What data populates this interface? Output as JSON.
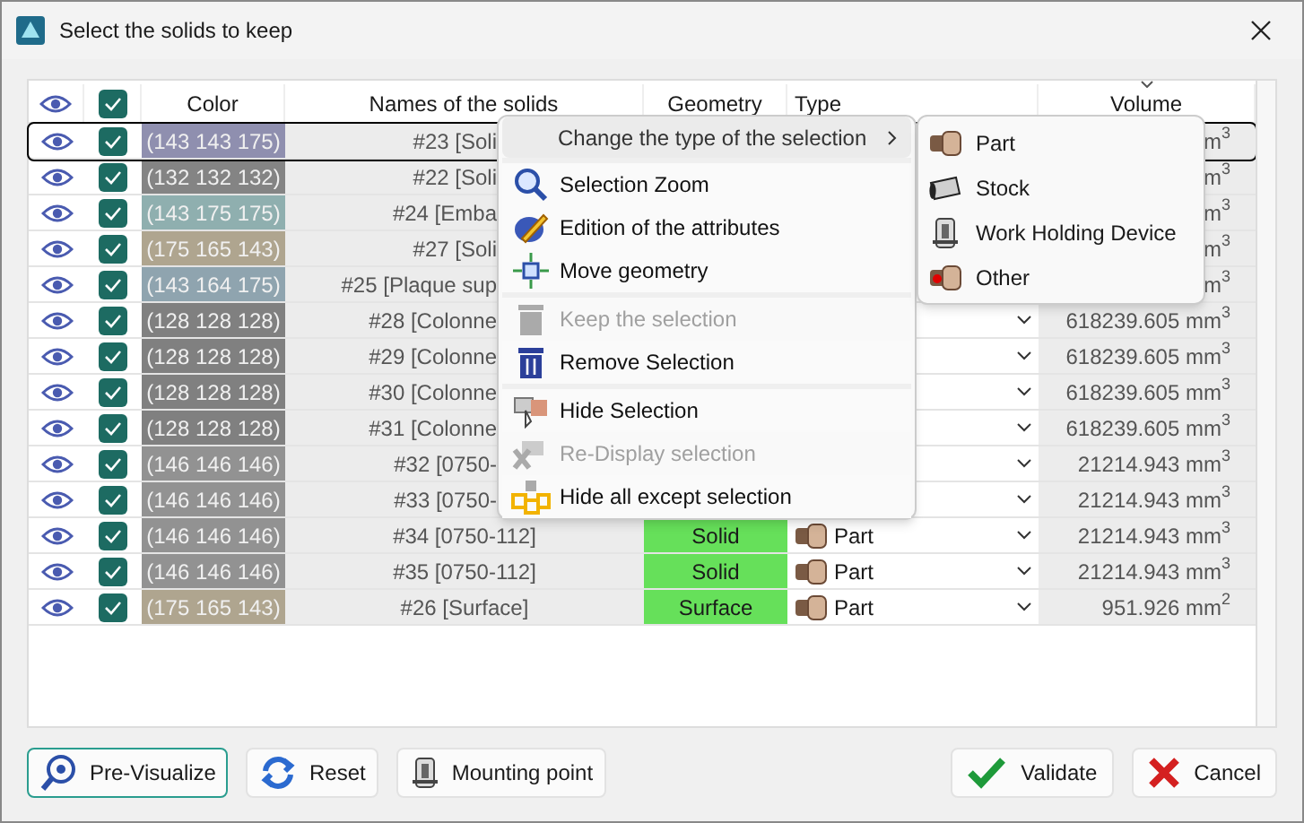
{
  "window": {
    "title": "Select the solids to keep"
  },
  "table": {
    "columns": [
      "Color",
      "Names of the solids",
      "Geometry",
      "Type",
      "Volume"
    ],
    "header_checked": true,
    "rows": [
      {
        "selected": true,
        "visible": true,
        "checked": true,
        "color": "#8f8faf",
        "color_text": "(143 143 175)",
        "name": "#23 [Soli",
        "volume": "m$^{3}$"
      },
      {
        "selected": false,
        "visible": true,
        "checked": true,
        "color": "#848484",
        "color_text": "(132 132 132)",
        "name": "#22 [Soli",
        "volume": "m$^{3}$"
      },
      {
        "selected": false,
        "visible": true,
        "checked": true,
        "color": "#8fafaf",
        "color_text": "(143 175 175)",
        "name": "#24 [Emba",
        "volume": "m$^{3}$"
      },
      {
        "selected": false,
        "visible": true,
        "checked": true,
        "color": "#afa58f",
        "color_text": "(175 165 143)",
        "name": "#27 [Soli",
        "volume": "m$^{3}$"
      },
      {
        "selected": false,
        "visible": true,
        "checked": true,
        "color": "#8fa4af",
        "color_text": "(143 164 175)",
        "name": "#25 [Plaque sup",
        "volume": "m$^{3}$"
      },
      {
        "selected": false,
        "visible": true,
        "checked": true,
        "color": "#808080",
        "color_text": "(128 128 128)",
        "name": "#28 [Colonne",
        "volume": "618239.605 mm$^{3}$"
      },
      {
        "selected": false,
        "visible": true,
        "checked": true,
        "color": "#808080",
        "color_text": "(128 128 128)",
        "name": "#29 [Colonne",
        "volume": "618239.605 mm$^{3}$"
      },
      {
        "selected": false,
        "visible": true,
        "checked": true,
        "color": "#808080",
        "color_text": "(128 128 128)",
        "name": "#30 [Colonne",
        "volume": "618239.605 mm$^{3}$"
      },
      {
        "selected": false,
        "visible": true,
        "checked": true,
        "color": "#808080",
        "color_text": "(128 128 128)",
        "name": "#31 [Colonne",
        "volume": "618239.605 mm$^{3}$"
      },
      {
        "selected": false,
        "visible": true,
        "checked": true,
        "color": "#929292",
        "color_text": "(146 146 146)",
        "name": "#32 [0750-",
        "volume": "21214.943 mm$^{3}$"
      },
      {
        "selected": false,
        "visible": true,
        "checked": true,
        "color": "#929292",
        "color_text": "(146 146 146)",
        "name": "#33 [0750-",
        "volume": "21214.943 mm$^{3}$"
      },
      {
        "selected": false,
        "visible": true,
        "checked": true,
        "color": "#929292",
        "color_text": "(146 146 146)",
        "name": "#34 [0750-112]",
        "geometry": "Solid",
        "type": "Part",
        "volume": "21214.943 mm$^{3}$"
      },
      {
        "selected": false,
        "visible": true,
        "checked": true,
        "color": "#929292",
        "color_text": "(146 146 146)",
        "name": "#35 [0750-112]",
        "geometry": "Solid",
        "type": "Part",
        "volume": "21214.943 mm$^{3}$"
      },
      {
        "selected": false,
        "visible": true,
        "checked": true,
        "color": "#afa58f",
        "color_text": "(175 165 143)",
        "name": "#26 [Surface]",
        "geometry": "Surface",
        "type": "Part",
        "volume": "951.926 mm$^{2}$"
      }
    ]
  },
  "context_menu": {
    "items": [
      {
        "kind": "submenu",
        "label": "Change the type of the selection",
        "disabled": false
      },
      {
        "kind": "separator"
      },
      {
        "kind": "item",
        "label": "Selection Zoom",
        "disabled": false
      },
      {
        "kind": "item",
        "label": "Edition of the attributes",
        "disabled": false
      },
      {
        "kind": "item",
        "label": "Move geometry",
        "disabled": false
      },
      {
        "kind": "separator"
      },
      {
        "kind": "item",
        "label": "Keep the selection",
        "disabled": true
      },
      {
        "kind": "item",
        "label": "Remove Selection",
        "disabled": false
      },
      {
        "kind": "separator"
      },
      {
        "kind": "item",
        "label": "Hide Selection",
        "disabled": false
      },
      {
        "kind": "item",
        "label": "Re-Display selection",
        "disabled": true
      },
      {
        "kind": "item",
        "label": "Hide all except selection",
        "disabled": false
      }
    ]
  },
  "submenu": {
    "items": [
      "Part",
      "Stock",
      "Work Holding Device",
      "Other"
    ]
  },
  "buttons_left": [
    {
      "label": "Pre-Visualize",
      "focused": true
    },
    {
      "label": "Reset",
      "focused": false
    },
    {
      "label": "Mounting point",
      "focused": false
    }
  ],
  "buttons_right": [
    {
      "label": "Validate",
      "focused": false
    },
    {
      "label": "Cancel",
      "focused": false
    }
  ]
}
